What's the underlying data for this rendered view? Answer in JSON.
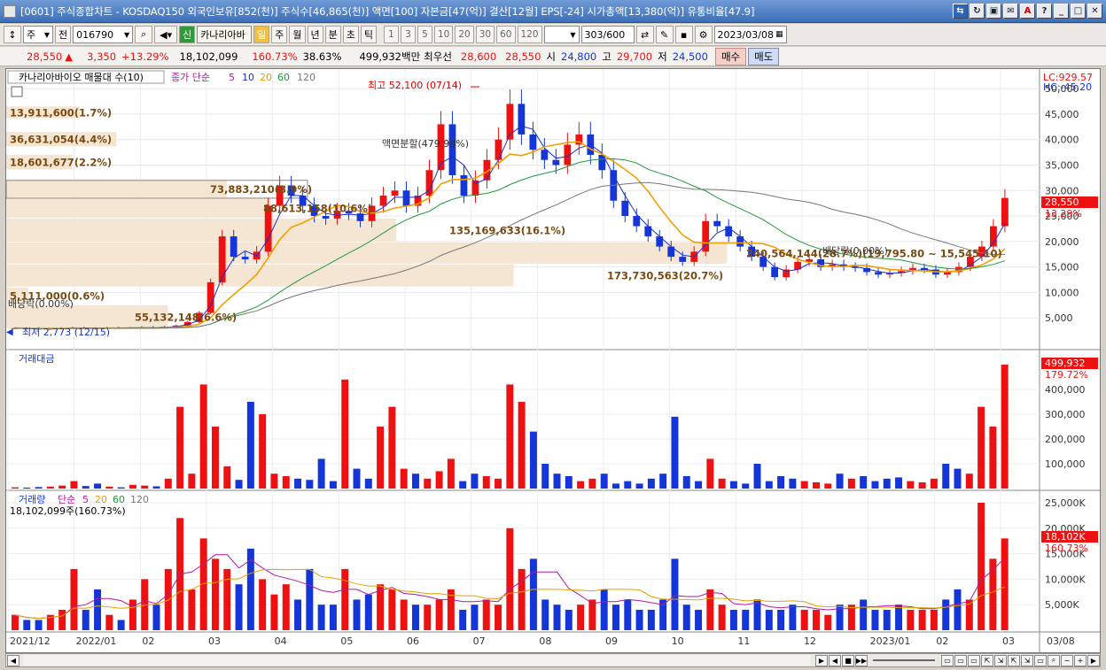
{
  "window": {
    "title": "[0601] 주식종합차트 - KOSDAQ150 외국인보유[852(천)] 주식수[46,865(천)] 액면[100] 자본금[47(억)] 결산[12월] EPS[-24] 시가총액[13,380(억)] 유통비율[47.9]"
  },
  "toolbar": {
    "market": "주",
    "jeon": "전",
    "code": "016790",
    "stock_name": "카나리아바",
    "periods": [
      "일",
      "주",
      "월",
      "년",
      "분",
      "초",
      "틱"
    ],
    "active_period": "일",
    "intervals": [
      "1",
      "3",
      "5",
      "10",
      "20",
      "30",
      "60",
      "120"
    ],
    "count": "303",
    "count_max": "/600",
    "date": "2023/03/08"
  },
  "price": {
    "current": "28,550",
    "change": "3,350",
    "change_pct": "+13.29%",
    "volume": "18,102,099",
    "vol_ratio": "160.73%",
    "turnover_rate": "38.63%",
    "amount": "499,932백만",
    "best_ask_label": "최우선",
    "best_ask": "28,600",
    "best_bid": "28,550",
    "open_label": "시",
    "open": "24,800",
    "high_label": "고",
    "high": "29,700",
    "low_label": "저",
    "low": "24,500",
    "buy": "매수",
    "sell": "매도"
  },
  "main_panel": {
    "legend_title": "카나리아바이오 매물대 수(10)",
    "ma_label": "종가 단순",
    "ma_periods": [
      "5",
      "10",
      "20",
      "60",
      "120"
    ],
    "lc": "LC:929.57",
    "hc": "HC:-45.20",
    "price_ticks": [
      "50,000",
      "45,000",
      "40,000",
      "35,000",
      "30,000",
      "25,000",
      "20,000",
      "15,000",
      "10,000",
      "5,000"
    ],
    "current_tag": "28,550",
    "current_pct": "13.29%",
    "high_label": "최고 52,100 (07/14)",
    "low_label": "최저 2,773 (12/15)",
    "event_split": "액면분할(479.98%)",
    "event_dividend": "배당락(0.00%)",
    "event_left": "배당락(0.00%)",
    "volume_profile": [
      {
        "label": "13,911,600(1.7%)"
      },
      {
        "label": "36,631,054(4.4%)"
      },
      {
        "label": "18,601,677(2.2%)"
      },
      {
        "label": "73,883,210(8.9%)"
      },
      {
        "label": "88,613,158(10.6%)"
      },
      {
        "label": "135,169,633(16.1%)"
      },
      {
        "label": "240,564,144(28.7%)(19,795.80 ~ 15,545.10)"
      },
      {
        "label": "173,730,563(20.7%)"
      },
      {
        "label": "5,111,000(0.6%)"
      },
      {
        "label": "55,132,148(6.6%)"
      }
    ]
  },
  "amount_panel": {
    "title": "거래대금",
    "ticks": [
      "400,000",
      "300,000",
      "200,000",
      "100,000"
    ],
    "current_tag": "499,932",
    "current_pct": "179.72%"
  },
  "volume_panel": {
    "title": "거래량",
    "ma_label": "단순",
    "ma_periods": [
      "5",
      "20",
      "60",
      "120"
    ],
    "value_line": "18,102,099주(160.73%)",
    "ticks": [
      "25,000K",
      "20,000K",
      "15,000K",
      "10,000K",
      "5,000K"
    ],
    "current_tag": "18,102K",
    "current_pct": "160.73%"
  },
  "x_axis": {
    "labels": [
      "2021/12",
      "2022/01",
      "02",
      "03",
      "04",
      "05",
      "06",
      "07",
      "08",
      "09",
      "10",
      "11",
      "12",
      "2023/01",
      "02",
      "03",
      "03/08"
    ]
  },
  "chart_data": {
    "type": "candlestick",
    "price_series": [
      3000,
      2900,
      2800,
      2900,
      3000,
      3100,
      3000,
      2950,
      3100,
      3000,
      3050,
      3200,
      3100,
      3300,
      3500,
      4200,
      6000,
      12000,
      21000,
      17000,
      16500,
      18000,
      27000,
      31000,
      29000,
      27000,
      25000,
      24500,
      26000,
      25500,
      24000,
      27000,
      29000,
      30000,
      27000,
      29000,
      34000,
      43000,
      33000,
      29000,
      32000,
      36000,
      40000,
      47000,
      41000,
      38000,
      36000,
      35000,
      39000,
      41000,
      37000,
      34000,
      28000,
      25000,
      23000,
      21000,
      19000,
      17000,
      16000,
      18000,
      24000,
      23000,
      21000,
      19000,
      17000,
      15000,
      13000,
      14500,
      16000,
      16500,
      15000,
      15500,
      15000,
      14800,
      14000,
      13500,
      13800,
      14200,
      14800,
      14500,
      13500,
      14000,
      15000,
      17000,
      19000,
      23000,
      28550
    ],
    "amount_series": [
      5,
      4,
      6,
      8,
      12,
      30,
      10,
      20,
      8,
      5,
      15,
      12,
      9,
      40,
      330,
      60,
      420,
      250,
      90,
      35,
      350,
      300,
      60,
      50,
      40,
      35,
      120,
      30,
      440,
      80,
      40,
      250,
      330,
      80,
      60,
      40,
      70,
      120,
      30,
      60,
      50,
      40,
      420,
      350,
      230,
      100,
      60,
      50,
      30,
      40,
      60,
      20,
      30,
      20,
      40,
      60,
      290,
      50,
      30,
      120,
      40,
      30,
      20,
      100,
      30,
      50,
      40,
      30,
      25,
      20,
      60,
      40,
      50,
      30,
      40,
      45,
      30,
      25,
      40,
      100,
      80,
      60,
      330,
      250,
      500
    ],
    "volume_series": [
      3,
      2,
      2,
      3,
      4,
      12,
      4,
      8,
      3,
      2,
      6,
      10,
      5,
      12,
      22,
      8,
      18,
      14,
      12,
      9,
      16,
      10,
      7,
      9,
      6,
      12,
      5,
      5,
      12,
      6,
      7,
      9,
      8,
      6,
      5,
      5,
      6,
      8,
      4,
      5,
      6,
      5,
      20,
      12,
      14,
      6,
      5,
      4,
      5,
      6,
      8,
      5,
      6,
      4,
      4,
      6,
      14,
      5,
      4,
      8,
      5,
      4,
      4,
      6,
      4,
      4,
      5,
      4,
      4,
      3,
      5,
      5,
      6,
      4,
      4,
      5,
      4,
      4,
      4,
      6,
      8,
      6,
      25,
      14,
      18
    ],
    "ylim_price": [
      0,
      52100
    ],
    "ylim_amount": [
      0,
      500000
    ],
    "ylim_volume": [
      0,
      25000
    ]
  }
}
